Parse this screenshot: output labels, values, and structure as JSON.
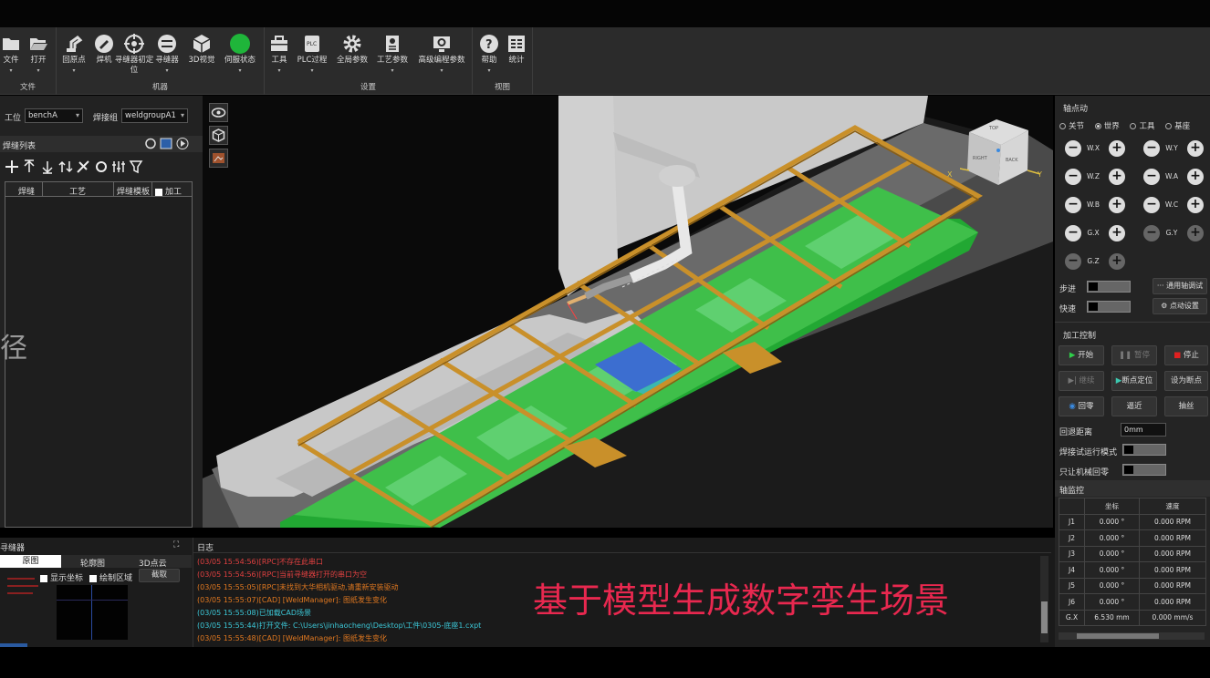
{
  "ribbon": {
    "groups": [
      {
        "label": "文件",
        "buttons": [
          {
            "label": "文件",
            "icon": "folder-icon"
          },
          {
            "label": "打开",
            "icon": "open-folder-icon"
          }
        ]
      },
      {
        "label": "机器",
        "buttons": [
          {
            "label": "回原点",
            "icon": "robot-arm-icon"
          },
          {
            "label": "焊机",
            "icon": "welder-icon"
          },
          {
            "label": "寻缝器初定位",
            "icon": "crosshair-icon"
          },
          {
            "label": "寻缝器",
            "icon": "seam-finder-icon"
          },
          {
            "label": "3D视觉",
            "icon": "cube-icon"
          },
          {
            "label": "伺服状态",
            "icon": "status-dot-icon"
          }
        ]
      },
      {
        "label": "设置",
        "buttons": [
          {
            "label": "工具",
            "icon": "toolbox-icon"
          },
          {
            "label": "PLC过程",
            "icon": "plc-icon"
          },
          {
            "label": "全局参数",
            "icon": "gear-icon"
          },
          {
            "label": "工艺参数",
            "icon": "document-icon"
          },
          {
            "label": "高级编程参数",
            "icon": "monitor-gear-icon"
          }
        ]
      },
      {
        "label": "视图",
        "buttons": [
          {
            "label": "帮助",
            "icon": "help-icon"
          },
          {
            "label": "统计",
            "icon": "stats-icon"
          }
        ]
      }
    ],
    "status_color": "#1fb53a"
  },
  "left": {
    "station_label": "工位",
    "station_value": "benchA",
    "group_label": "焊接组",
    "group_value": "weldgroupA1",
    "list_title": "焊缝列表",
    "columns": [
      "焊缝",
      "工艺",
      "焊缝模板",
      "加工"
    ],
    "overflow_char": "径"
  },
  "viewport": {
    "cube_labels": {
      "top": "TOP",
      "left": "RIGHT",
      "front": "BACK"
    },
    "axis_x": "X",
    "axis_y": "Y",
    "caption": "基于模型生成数字孪生场景",
    "caption_color": "#e8284f"
  },
  "right": {
    "jog_title": "轴点动",
    "modes": [
      "关节",
      "世界",
      "工具",
      "基座"
    ],
    "selected_mode": "世界",
    "axes": [
      "W.X",
      "W.Y",
      "W.Z",
      "W.A",
      "W.B",
      "W.C",
      "G.X",
      "G.Y",
      "G.Z"
    ],
    "step_label": "步进",
    "fast_label": "快速",
    "general_jog": "通用轴调试",
    "jog_settings": "点动设置",
    "proc_title": "加工控制",
    "start": "开始",
    "pause": "暂停",
    "stop": "停止",
    "resume": "继续",
    "bp_locate": "断点定位",
    "set_bp": "设为断点",
    "home": "回零",
    "approach": "逼近",
    "retract": "抽丝",
    "retract_dist_label": "回退距离",
    "retract_dist_value": "0mm",
    "weld_test_label": "焊接试运行模式",
    "robot_home_label": "只让机械回零",
    "monitor_title": "轴监控",
    "monitor_headers": [
      "",
      "坐标",
      "速度"
    ],
    "monitor_rows": [
      [
        "J1",
        "0.000 °",
        "0.000 RPM"
      ],
      [
        "J2",
        "0.000 °",
        "0.000 RPM"
      ],
      [
        "J3",
        "0.000 °",
        "0.000 RPM"
      ],
      [
        "J4",
        "0.000 °",
        "0.000 RPM"
      ],
      [
        "J5",
        "0.000 °",
        "0.000 RPM"
      ],
      [
        "J6",
        "0.000 °",
        "0.000 RPM"
      ],
      [
        "G.X",
        "6.530 mm",
        "0.000 mm/s"
      ]
    ]
  },
  "bottom": {
    "seam_title": "寻缝器",
    "seam_tabs": [
      "原图",
      "轮廓图",
      "3D点云"
    ],
    "show_coords": "显示坐标",
    "draw_region": "绘制区域",
    "capture": "截取",
    "log_title": "日志",
    "logs": [
      {
        "text": "(03/05 15:54:56)[RPC]不存在此串口",
        "color": "#e04040"
      },
      {
        "text": "(03/05 15:54:56)[RPC]当前寻缝器打开的串口为空",
        "color": "#e04040"
      },
      {
        "text": "(03/05 15:55:05)[RPC]未找到大华相机驱动,请重新安装驱动",
        "color": "#e07820"
      },
      {
        "text": "(03/05 15:55:07)[CAD] [WeldManager]: 图纸发生变化",
        "color": "#e07820"
      },
      {
        "text": "(03/05 15:55:08)已加载CAD场景",
        "color": "#3cc8d8"
      },
      {
        "text": "(03/05 15:55:44)打开文件: C:\\Users\\jinhaocheng\\Desktop\\工件\\0305-底座1.cxpt",
        "color": "#3cc8d8"
      },
      {
        "text": "(03/05 15:55:48)[CAD] [WeldManager]: 图纸发生变化",
        "color": "#e07820"
      }
    ]
  }
}
